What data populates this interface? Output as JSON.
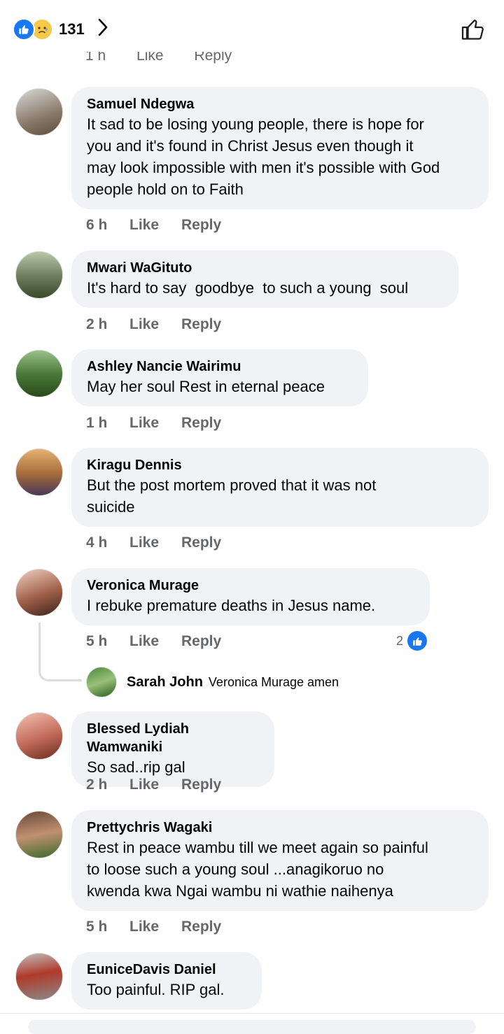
{
  "header": {
    "reaction_count": "131",
    "reaction_icons": [
      "like-reaction-icon",
      "sad-reaction-icon"
    ]
  },
  "previous_actions": {
    "time": "1 h",
    "like": "Like",
    "reply": "Reply"
  },
  "comments": [
    {
      "author": "Samuel Ndegwa",
      "text": "It sad to be losing young people, there is hope for\nyou and it's found in Christ Jesus even though it\nmay look impossible with men it's possible with God\npeople hold on to Faith",
      "time": "6 h",
      "like": "Like",
      "reply": "Reply"
    },
    {
      "author": "Mwari WaGituto",
      "text": "It's hard to say  goodbye  to such a young  soul",
      "time": "2 h",
      "like": "Like",
      "reply": "Reply"
    },
    {
      "author": "Ashley Nancie Wairimu",
      "text": "May her soul Rest in eternal peace",
      "time": "1 h",
      "like": "Like",
      "reply": "Reply"
    },
    {
      "author": "Kiragu Dennis",
      "text": "But the post mortem proved that it was not\nsuicide",
      "time": "4 h",
      "like": "Like",
      "reply": "Reply"
    },
    {
      "author": "Veronica Murage",
      "text": "I rebuke premature deaths in Jesus name.",
      "time": "5 h",
      "like": "Like",
      "reply": "Reply",
      "reaction_count": "2"
    },
    {
      "author": "Blessed Lydiah Wamwaniki",
      "text": "So sad..rip gal",
      "time": "2 h",
      "like": "Like",
      "reply": "Reply"
    },
    {
      "author": "Prettychris Wagaki",
      "text": "Rest in peace wambu till we meet again so painful\nto loose such a young soul ...anagikoruo no\nkwenda kwa Ngai wambu ni wathie naihenya",
      "time": "5 h",
      "like": "Like",
      "reply": "Reply"
    },
    {
      "author": "EuniceDavis Daniel",
      "text": "Too painful. RIP gal.",
      "time": "",
      "like": "",
      "reply": ""
    }
  ],
  "reply": {
    "author": "Sarah John",
    "text": "Veronica Murage amen"
  },
  "colors": {
    "accent": "#1877f2",
    "bubble": "#f0f2f5",
    "muted": "#65676b"
  }
}
